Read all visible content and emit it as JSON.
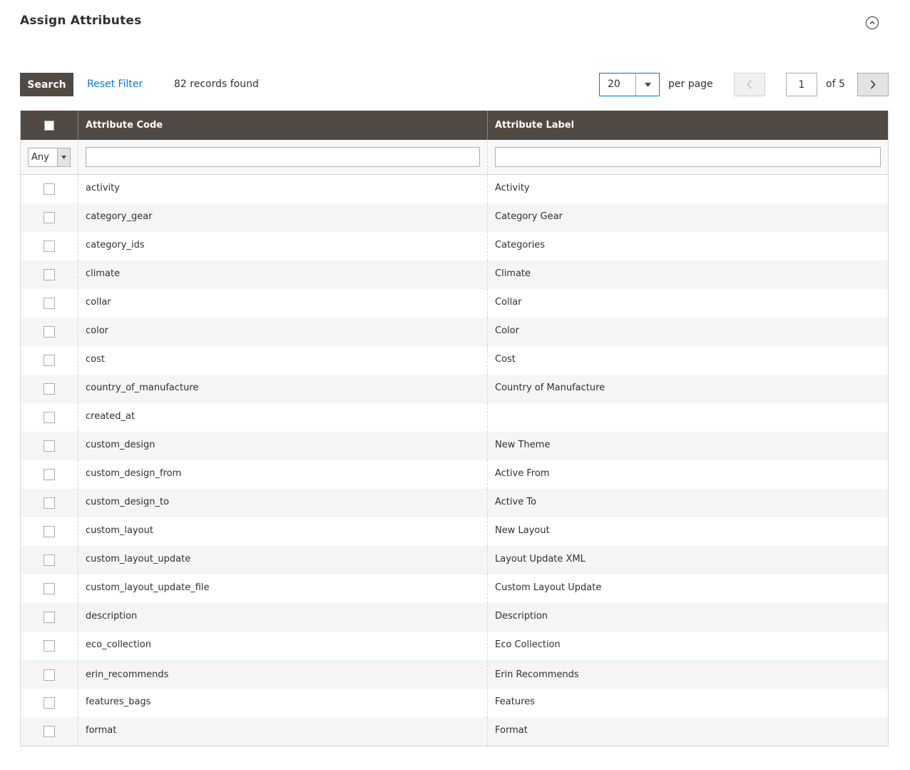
{
  "section": {
    "title": "Assign Attributes"
  },
  "toolbar": {
    "search_label": "Search",
    "reset_label": "Reset Filter",
    "records_text": "82 records found",
    "per_page_value": "20",
    "per_page_label": "per page",
    "current_page": "1",
    "of_pages": "of 5"
  },
  "grid": {
    "columns": [
      "Attribute Code",
      "Attribute Label"
    ],
    "filter": {
      "any_value": "Any",
      "code_value": "",
      "label_value": ""
    },
    "rows": [
      {
        "code": "activity",
        "label": "Activity"
      },
      {
        "code": "category_gear",
        "label": "Category Gear"
      },
      {
        "code": "category_ids",
        "label": "Categories"
      },
      {
        "code": "climate",
        "label": "Climate"
      },
      {
        "code": "collar",
        "label": "Collar"
      },
      {
        "code": "color",
        "label": "Color"
      },
      {
        "code": "cost",
        "label": "Cost"
      },
      {
        "code": "country_of_manufacture",
        "label": "Country of Manufacture"
      },
      {
        "code": "created_at",
        "label": ""
      },
      {
        "code": "custom_design",
        "label": "New Theme"
      },
      {
        "code": "custom_design_from",
        "label": "Active From"
      },
      {
        "code": "custom_design_to",
        "label": "Active To"
      },
      {
        "code": "custom_layout",
        "label": "New Layout"
      },
      {
        "code": "custom_layout_update",
        "label": "Layout Update XML"
      },
      {
        "code": "custom_layout_update_file",
        "label": "Custom Layout Update"
      },
      {
        "code": "description",
        "label": "Description"
      },
      {
        "code": "eco_collection",
        "label": "Eco Collection"
      },
      {
        "code": "erin_recommends",
        "label": "Erin Recommends"
      },
      {
        "code": "features_bags",
        "label": "Features"
      },
      {
        "code": "format",
        "label": "Format"
      }
    ]
  },
  "colors": {
    "header_bg": "#514943",
    "link": "#007bdb",
    "accent_border": "#007bdb"
  }
}
